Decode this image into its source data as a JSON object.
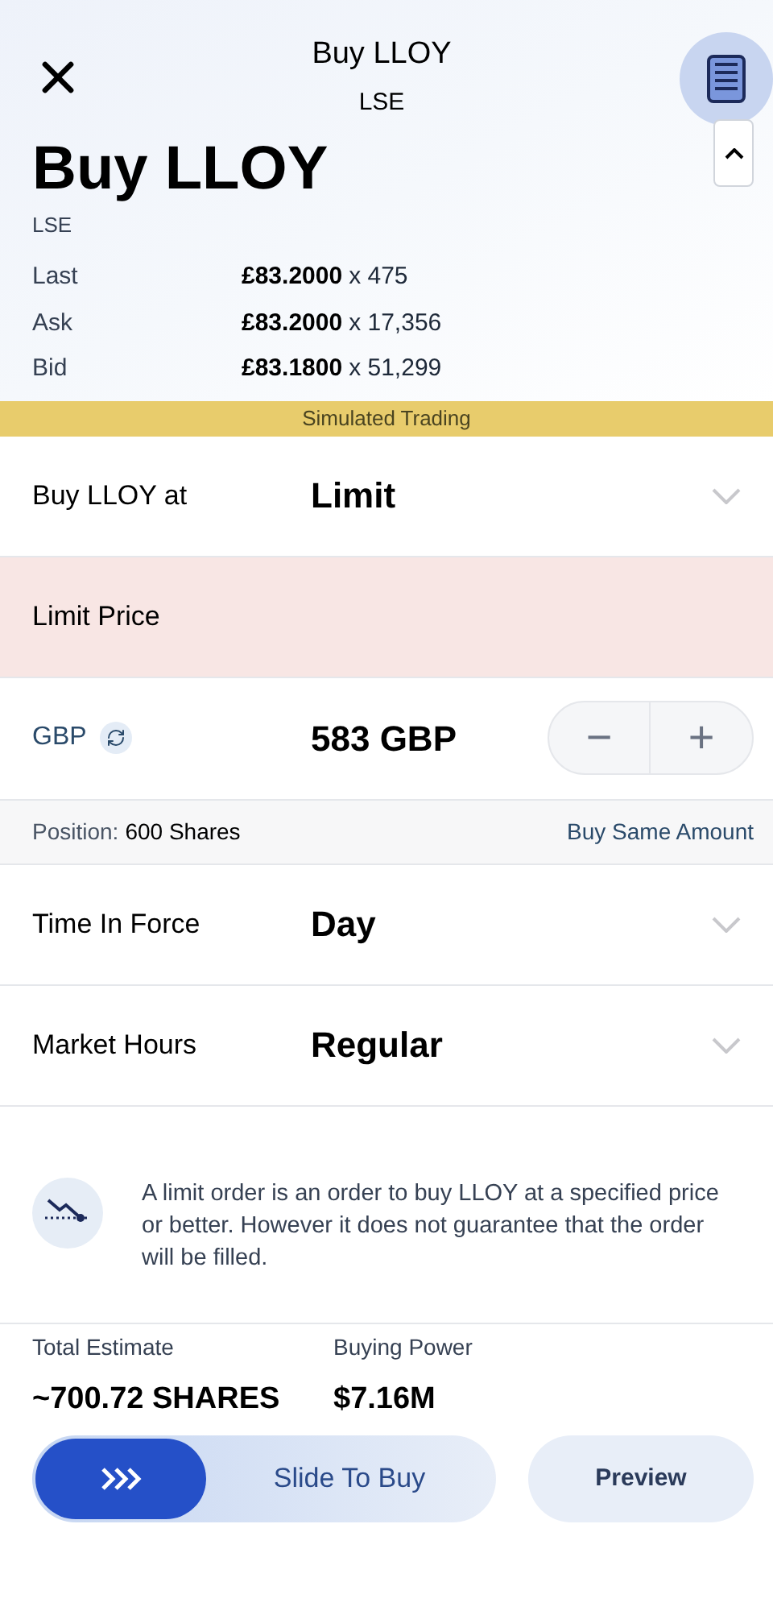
{
  "header": {
    "title": "Buy LLOY",
    "subtitle": "LSE"
  },
  "heading": {
    "title": "Buy LLOY",
    "exchange": "LSE"
  },
  "quotes": [
    {
      "label": "Last",
      "price": "£83.2000",
      "size": "x 475"
    },
    {
      "label": "Ask",
      "price": "£83.2000",
      "size": "x 17,356"
    },
    {
      "label": "Bid",
      "price": "£83.1800",
      "size": "x 51,299"
    }
  ],
  "banner": "Simulated Trading",
  "order_type": {
    "label": "Buy LLOY at",
    "value": "Limit"
  },
  "limit_price": {
    "label": "Limit Price",
    "highlighted": true
  },
  "amount": {
    "currency": "GBP",
    "value": "583 GBP",
    "minus": "−",
    "plus": "+"
  },
  "position": {
    "label": "Position:",
    "value": "600 Shares",
    "link": "Buy Same Amount"
  },
  "options": [
    {
      "label": "Time In Force",
      "value": "Day"
    },
    {
      "label": "Market Hours",
      "value": "Regular"
    }
  ],
  "info": "A limit order is an order to buy LLOY at a specified price or better. However it does not guarantee that the order will be filled.",
  "totals": [
    {
      "label": "Total Estimate",
      "value": "~700.72 SHARES"
    },
    {
      "label": "Buying Power",
      "value": "$7.16M"
    }
  ],
  "slide_button": {
    "label": "Slide To Buy",
    "level": 0
  },
  "preview_button": "Preview"
}
